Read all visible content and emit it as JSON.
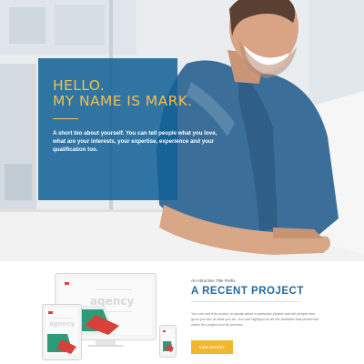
{
  "hero": {
    "greeting_line1": "HELLO.",
    "greeting_line2": "MY NAME IS MARK.",
    "bio": "A short bio about yourself. You can tell people what you love, what are your interests, your expertise, experience and your qualification too."
  },
  "project": {
    "prefix": "An Attractive Title Prefix",
    "title": "A RECENT PROJECT",
    "description": "You can use this section to speak about a particular project and tell people how good you are at what you do. You can highlight on all the activities that performed within the project and its process.",
    "button_label": "VIEW RECENT",
    "mockup_word": "agency"
  },
  "colors": {
    "hero_panel": "#126096",
    "accent_yellow": "#f2c14b",
    "button": "#f2b633",
    "title_blue": "#1f6aa0"
  }
}
